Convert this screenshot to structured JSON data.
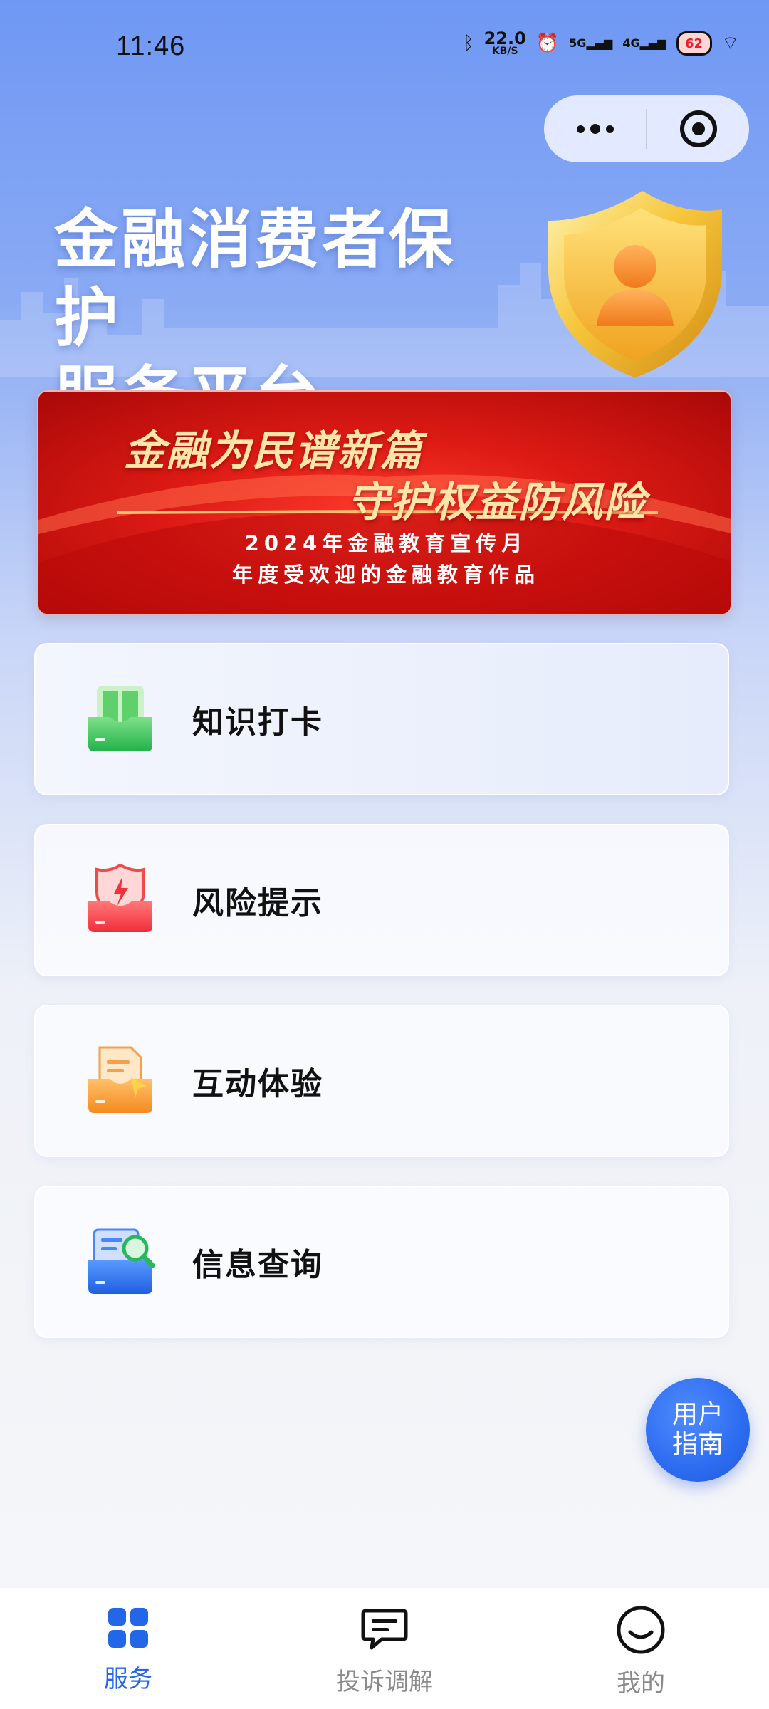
{
  "status_bar": {
    "time": "11:46",
    "net_speed": "22.0",
    "net_unit": "KB/S",
    "sim1": "5G",
    "sim2": "4G",
    "battery": "62"
  },
  "capsule": {
    "more_icon": "more-dots-icon",
    "close_icon": "target-circle-icon"
  },
  "hero": {
    "title_line1": "金融消费者保护",
    "title_line2": "服务平台"
  },
  "banner": {
    "line1": "金融为民谱新篇",
    "line2": "守护权益防风险",
    "line3": "2024年金融教育宣传月",
    "line4": "年度受欢迎的金融教育作品"
  },
  "menu": [
    {
      "label": "知识打卡",
      "icon": "green-book-icon"
    },
    {
      "label": "风险提示",
      "icon": "red-shield-warning-icon"
    },
    {
      "label": "互动体验",
      "icon": "orange-document-icon"
    },
    {
      "label": "信息查询",
      "icon": "blue-search-icon"
    }
  ],
  "guide_button": {
    "line1": "用户",
    "line2": "指南"
  },
  "tabbar": {
    "tabs": [
      {
        "label": "服务",
        "icon": "grid-icon",
        "active": true
      },
      {
        "label": "投诉调解",
        "icon": "chat-bubble-icon",
        "active": false
      },
      {
        "label": "我的",
        "icon": "smiley-icon",
        "active": false
      }
    ]
  },
  "colors": {
    "accent": "#2167e8",
    "banner_red": "#dc1a14",
    "banner_gold": "#ffe6a8",
    "shield_gold": "#f2b324"
  }
}
